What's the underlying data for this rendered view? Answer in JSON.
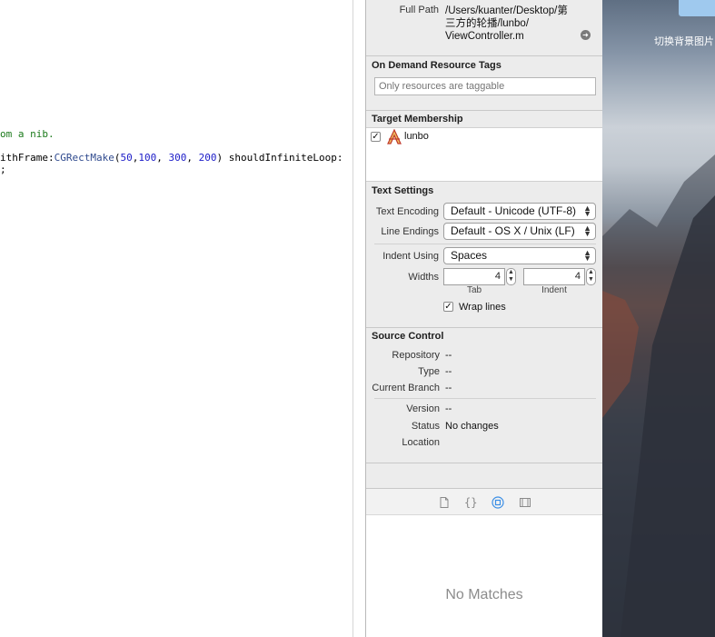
{
  "editor": {
    "lines": [
      {
        "text": "om a nib."
      },
      {
        "prefix": "ithFrame:",
        "call": "CGRectMake",
        "args": [
          "50",
          "100",
          "300",
          "200"
        ],
        "suffix": " shouldInfiniteLoop:"
      },
      {
        "text": ";"
      }
    ]
  },
  "inspector": {
    "file": {
      "full_path_label": "Full Path",
      "full_path_line1": "/Users/kuanter/Desktop/第",
      "full_path_line2": "三方的轮播/lunbo/",
      "full_path_line3": "ViewController.m",
      "reveal_icon": "arrow-circle-right-icon"
    },
    "on_demand": {
      "title": "On Demand Resource Tags",
      "placeholder": "Only resources are taggable"
    },
    "target_membership": {
      "title": "Target Membership",
      "target_name": "lunbo",
      "checked": true
    },
    "text_settings": {
      "title": "Text Settings",
      "encoding_label": "Text Encoding",
      "encoding_value": "Default - Unicode (UTF-8)",
      "line_endings_label": "Line Endings",
      "line_endings_value": "Default - OS X / Unix (LF)",
      "indent_using_label": "Indent Using",
      "indent_using_value": "Spaces",
      "widths_label": "Widths",
      "tab_width": "4",
      "indent_width": "4",
      "tab_label": "Tab",
      "indent_label": "Indent",
      "wrap_lines_label": "Wrap lines",
      "wrap_lines_checked": true
    },
    "source_control": {
      "title": "Source Control",
      "repository_label": "Repository",
      "repository_value": "--",
      "type_label": "Type",
      "type_value": "--",
      "branch_label": "Current Branch",
      "branch_value": "--",
      "version_label": "Version",
      "version_value": "--",
      "status_label": "Status",
      "status_value": "No changes",
      "location_label": "Location",
      "location_value": ""
    },
    "library": {
      "tabs": [
        "file-template-icon",
        "code-snippet-icon",
        "object-library-icon",
        "media-library-icon"
      ],
      "selected_tab": 2,
      "empty_text": "No Matches"
    }
  },
  "desktop": {
    "folder_label": "切换背景图片"
  },
  "colors": {
    "accent": "#4a90d9",
    "comment": "#1b7a1b",
    "number": "#1c1cc8"
  }
}
